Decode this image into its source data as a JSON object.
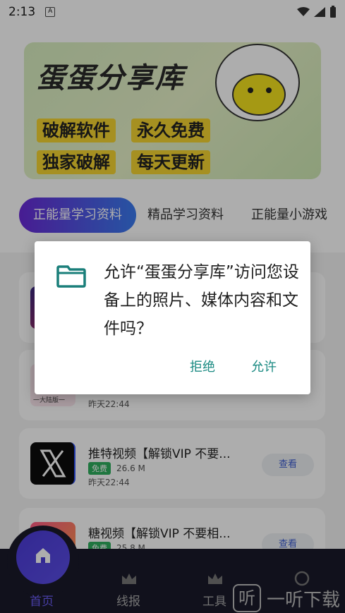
{
  "status_bar": {
    "time": "2:13",
    "notification_icon": "A"
  },
  "banner": {
    "title": "蛋蛋分享库",
    "tags": [
      "破解软件",
      "永久免费",
      "独家破解",
      "每天更新"
    ]
  },
  "tabs": [
    "正能量学习资料",
    "精品学习资料",
    "正能量小游戏"
  ],
  "list": [
    {
      "title": "",
      "badge": "",
      "size": "",
      "date": ""
    },
    {
      "title": "",
      "badge": "",
      "size": "",
      "date": "昨天22:44",
      "thumb_caption": "一大陆版一"
    },
    {
      "title": "推特视频【解锁VIP 不要...",
      "badge": "免费",
      "size": "26.6 M",
      "date": "昨天22:44",
      "button": "查看"
    },
    {
      "title": "糖视频【解锁VIP 不要相...",
      "badge": "免费",
      "size": "25.8 M",
      "date": "",
      "button": "查看"
    }
  ],
  "bottom_nav": {
    "items": [
      "首页",
      "线报",
      "工具"
    ]
  },
  "watermark": {
    "box": "听",
    "text": "一听下载"
  },
  "dialog": {
    "message": "允许“蛋蛋分享库”访问您设备上的照片、媒体内容和文件吗？",
    "deny_label": "拒绝",
    "allow_label": "允许"
  },
  "colors": {
    "accent": "#1a8a82",
    "tab_gradient_start": "#6a2ad8",
    "tab_gradient_end": "#3a7cf0",
    "nav_bg": "#1a1a2a"
  }
}
